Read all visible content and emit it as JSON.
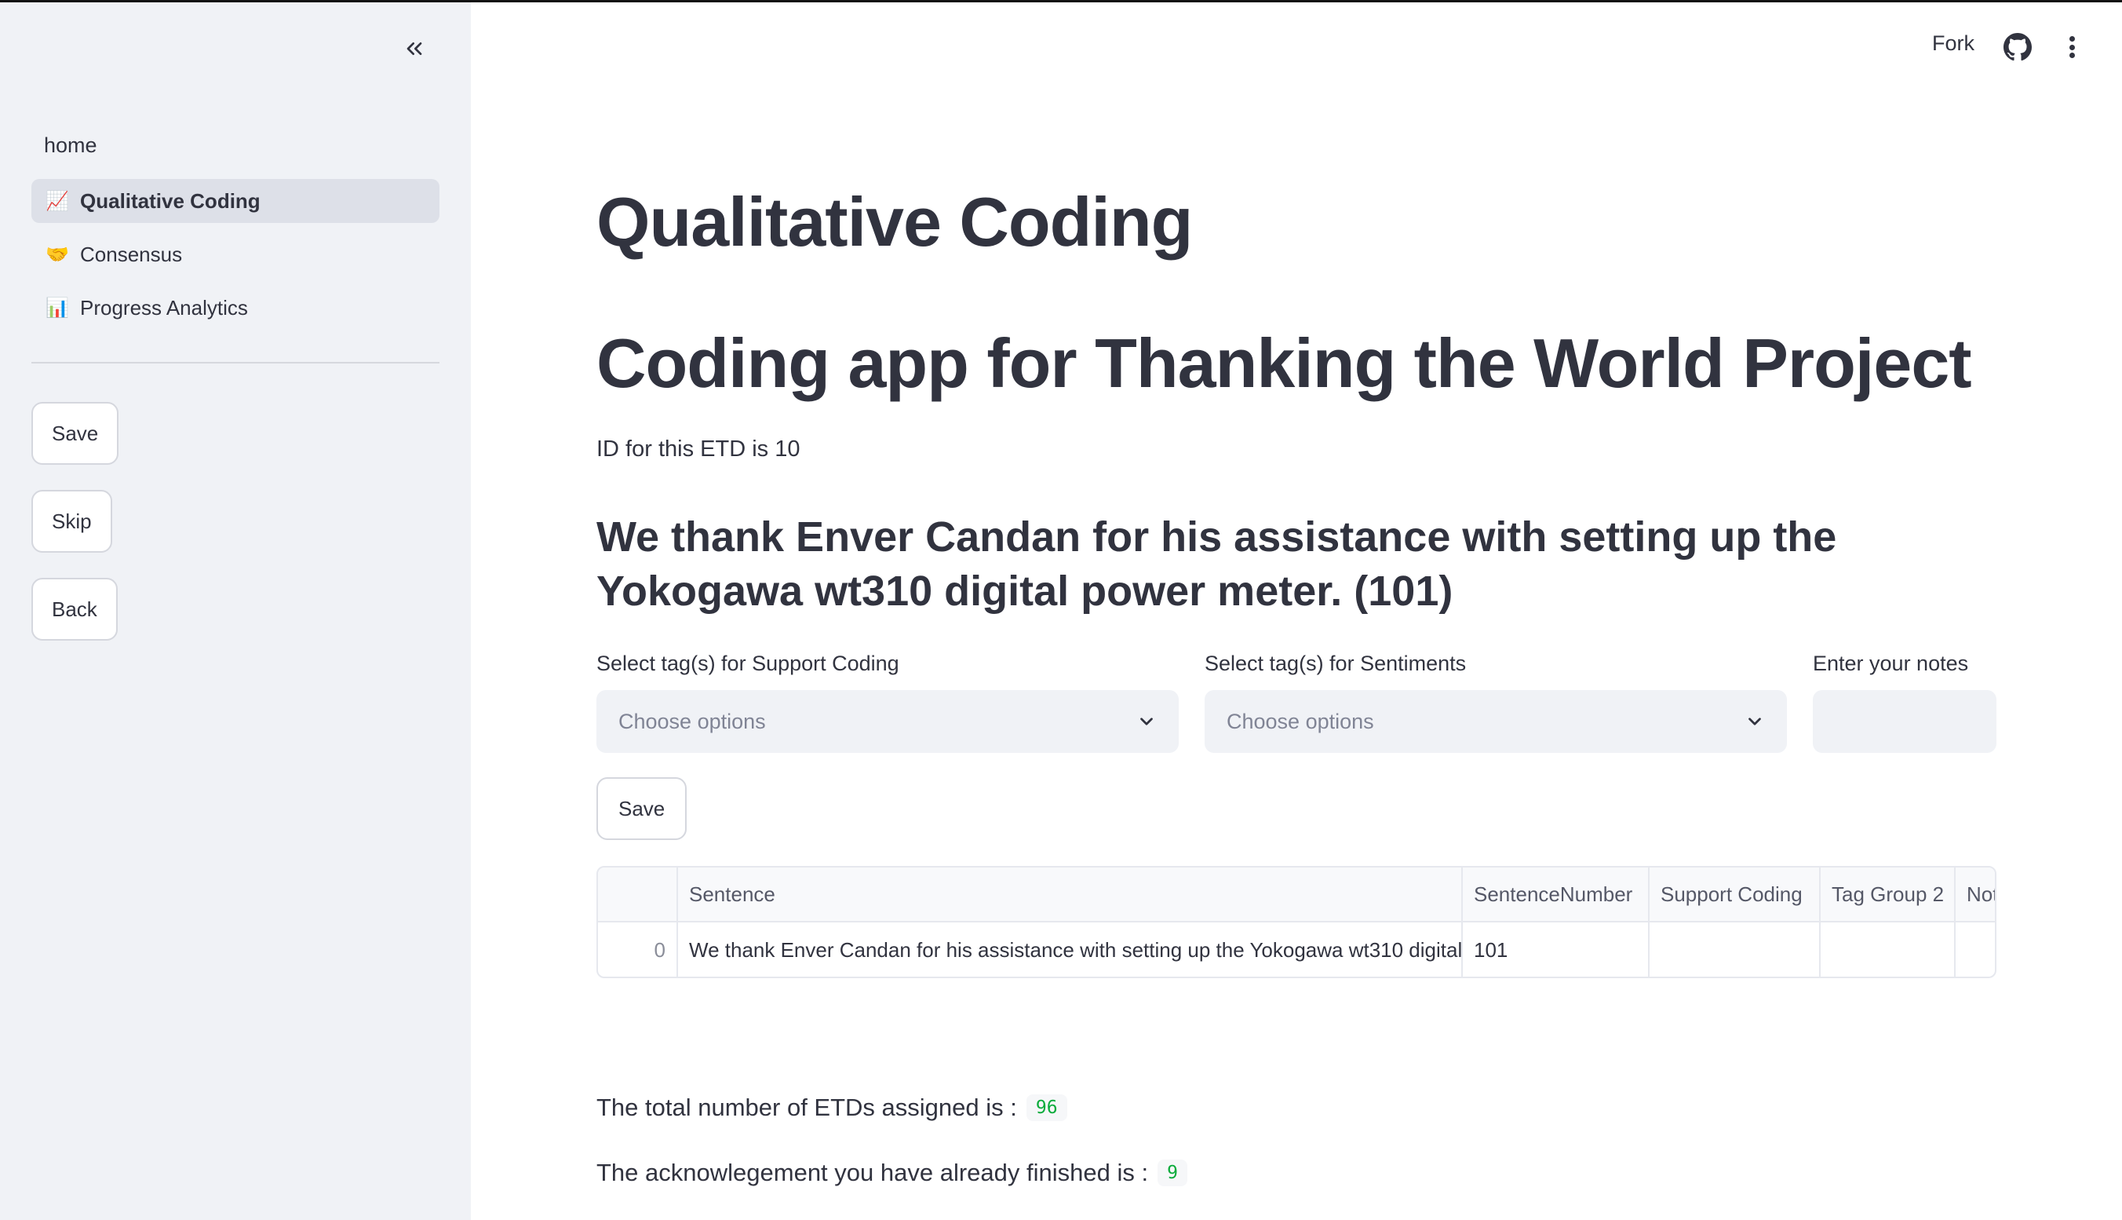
{
  "header": {
    "fork_label": "Fork",
    "github_icon": "github-icon",
    "menu_icon": "kebab-menu-icon"
  },
  "sidebar": {
    "collapse_icon": "double-chevron-left-icon",
    "home_label": "home",
    "items": [
      {
        "emoji": "📈",
        "label": "Qualitative Coding",
        "active": true
      },
      {
        "emoji": "🤝",
        "label": "Consensus",
        "active": false
      },
      {
        "emoji": "📊",
        "label": "Progress Analytics",
        "active": false
      }
    ],
    "buttons": {
      "save": "Save",
      "skip": "Skip",
      "back": "Back"
    }
  },
  "main": {
    "title": "Qualitative Coding",
    "subtitle": "Coding app for Thanking the World Project",
    "etd_text": "ID for this ETD is 10",
    "sentence_heading": "We thank Enver Candan for his assistance with setting up the Yokogawa wt310 digital power meter. (101)",
    "support_label": "Select tag(s) for Support Coding",
    "support_placeholder": "Choose options",
    "sentiment_label": "Select tag(s) for Sentiments",
    "sentiment_placeholder": "Choose options",
    "notes_label": "Enter your notes",
    "notes_value": "",
    "save_label": "Save",
    "table": {
      "columns": [
        "",
        "Sentence",
        "SentenceNumber",
        "Support Coding",
        "Tag Group 2",
        "Not"
      ],
      "rows": [
        [
          "0",
          "We thank Enver Candan for his assistance with setting up the Yokogawa wt310 digital",
          "101",
          "",
          "",
          ""
        ]
      ]
    },
    "total_label": "The total number of ETDs assigned is :",
    "total_value": "96",
    "finished_label": "The acknowlegement you have already finished is :",
    "finished_value": "9"
  },
  "colors": {
    "sidebar_bg": "#f0f2f6",
    "active_item_bg": "#dde0e8",
    "text": "#31333f",
    "code_green": "#09ab3b"
  }
}
